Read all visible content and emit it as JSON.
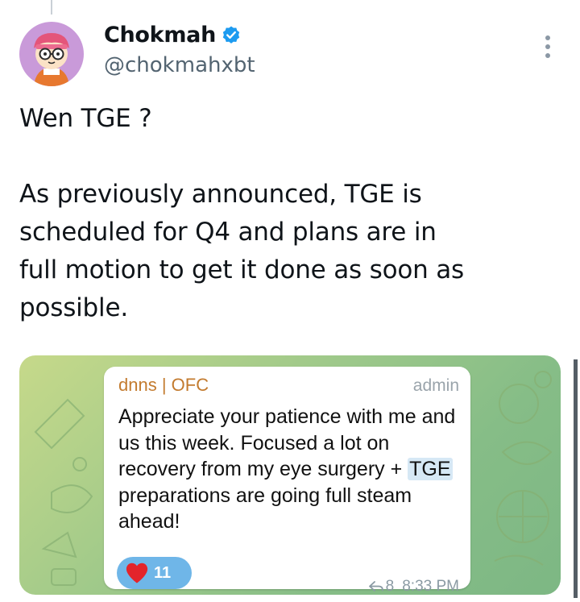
{
  "tweet": {
    "display_name": "Chokmah",
    "handle": "@chokmahxbt",
    "text": "Wen TGE ?\n\nAs previously announced, TGE is\nscheduled for Q4 and plans are in\nfull motion to get it done as soon as\npossible."
  },
  "embedded_message": {
    "sender": "dnns | OFC",
    "badge": "admin",
    "text_before": "Appreciate your patience with me and us this week. Focused a lot on recovery from my eye surgery + ",
    "highlight": "TGE",
    "text_after": " preparations are going full steam ahead!",
    "reaction_count": "11",
    "reply_count": "8",
    "time": "8:33 PM"
  },
  "icons": {
    "verified": "verified-badge-icon",
    "more": "more-options-icon",
    "reaction": "heart-icon",
    "reply": "reply-arrow-icon"
  },
  "colors": {
    "verified_blue": "#1d9bf0",
    "sender_orange": "#c37b2f",
    "reaction_blue": "#6fb6e8",
    "heart_red": "#e3242b",
    "chat_bg_green": "#9fc98a"
  }
}
